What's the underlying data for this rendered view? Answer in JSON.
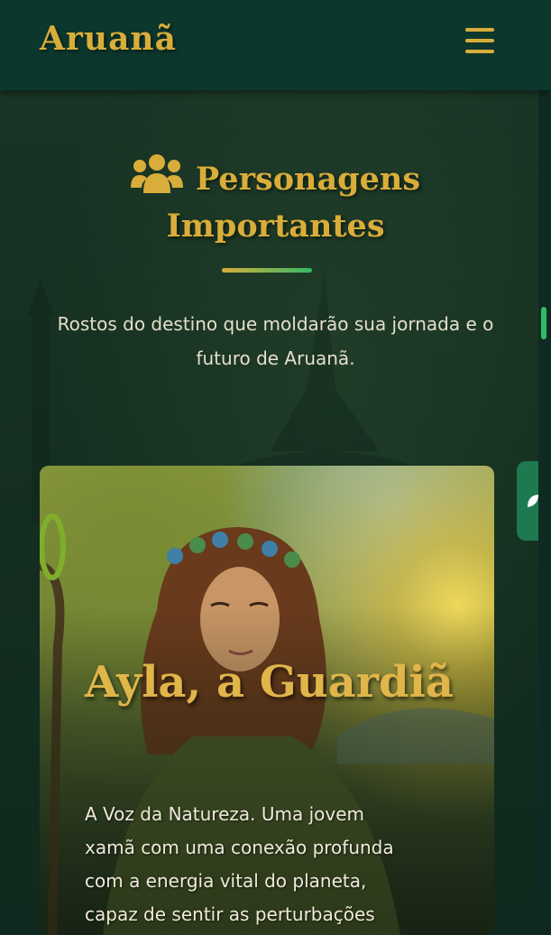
{
  "header": {
    "logo": "Aruanã",
    "menu_icon": "hamburger-menu-icon"
  },
  "section": {
    "icon": "users-group-icon",
    "title": "Personagens Importantes",
    "subtitle": "Rostos do destino que moldarão sua jornada e o futuro de Aruanã."
  },
  "card": {
    "title": "Ayla, a Guardiã",
    "description": "A Voz da Natureza. Uma jovem xamã com uma conexão profunda com a energia vital do planeta, capaz de sentir as perturbações"
  },
  "side_tab": {
    "icon": "leaf-icon"
  },
  "colors": {
    "accent_gold": "#d9ad3a",
    "header_bg": "#0c372d",
    "accent_green": "#33b866",
    "page_bg": "#10291e"
  }
}
